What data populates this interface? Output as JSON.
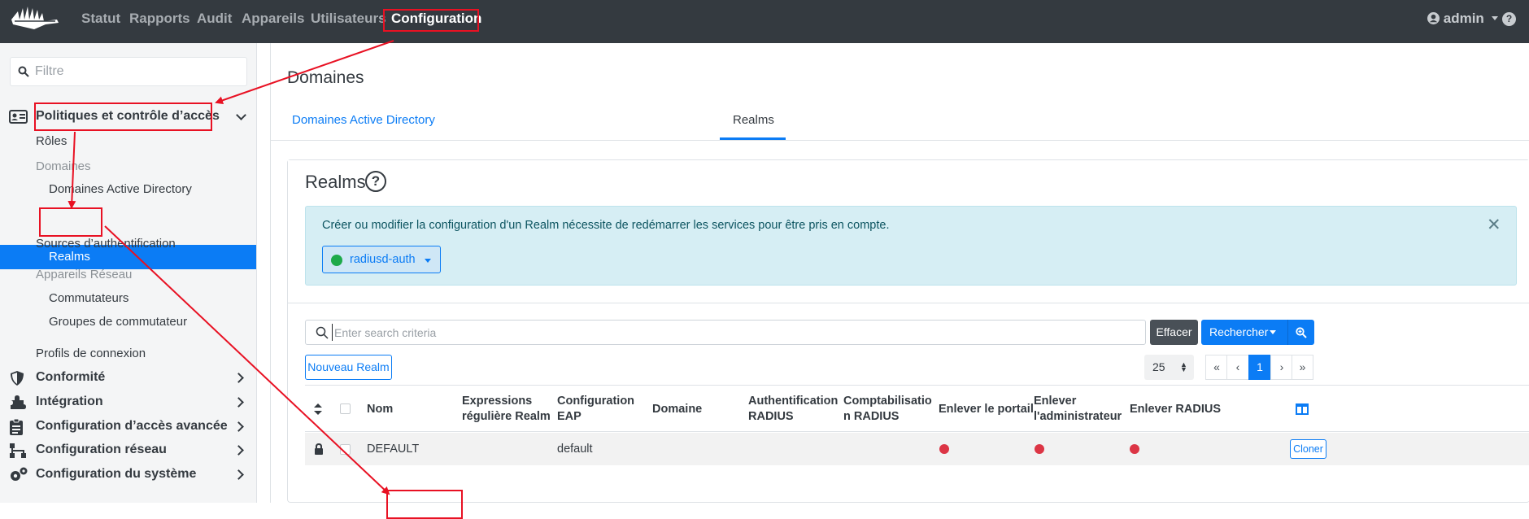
{
  "topnav": {
    "items": [
      "Statut",
      "Rapports",
      "Audit",
      "Appareils",
      "Utilisateurs",
      "Configuration"
    ],
    "active": "Configuration",
    "user": "admin"
  },
  "sidebar": {
    "filter_placeholder": "Filtre",
    "section_access": "Politiques et contrôle d’accès",
    "roles": "Rôles",
    "domains_group": "Domaines",
    "ad_domains": "Domaines Active Directory",
    "realms": "Realms",
    "auth_sources": "Sources d’authentification",
    "network_devices_group": "Appareils Réseau",
    "switches": "Commutateurs",
    "switch_groups": "Groupes de commutateur",
    "connection_profiles": "Profils de connexion",
    "compliance": "Conformité",
    "integration": "Intégration",
    "advanced_access": "Configuration d’accès avancée",
    "network_config": "Configuration réseau",
    "system_config": "Configuration du système"
  },
  "main": {
    "title": "Domaines",
    "tabs": [
      "Domaines Active Directory",
      "Realms"
    ],
    "card_title": "Realms",
    "alert_text": "Créer ou modifier la configuration d'un Realm nécessite de redémarrer les services pour être pris en compte.",
    "service_button": "radiusd-auth",
    "search_placeholder": "Enter search criteria",
    "clear_button": "Effacer",
    "search_button": "Rechercher",
    "new_button": "Nouveau Realm",
    "per_page": "25",
    "pagination": [
      "«",
      "‹",
      "1",
      "›",
      "»"
    ],
    "columns": {
      "name": "Nom",
      "regex1": "Expressions",
      "regex2": "régulière Realm",
      "eap1": "Configuration",
      "eap2": "EAP",
      "domain": "Domaine",
      "auth1": "Authentification",
      "auth2": "RADIUS",
      "acct1": "Comptabilisatio",
      "acct2": "n RADIUS",
      "strip_portal": "Enlever le portail",
      "strip_admin1": "Enlever",
      "strip_admin2": "l'administrateur",
      "strip_radius": "Enlever RADIUS"
    },
    "rows": [
      {
        "name": "DEFAULT",
        "eap": "default",
        "clone": "Cloner"
      }
    ]
  },
  "colors": {
    "topbar": "#343a40",
    "accent": "#0b7cf5",
    "annotation": "#e81123",
    "status_green": "#1eaa4a",
    "status_red": "#dc3545"
  }
}
